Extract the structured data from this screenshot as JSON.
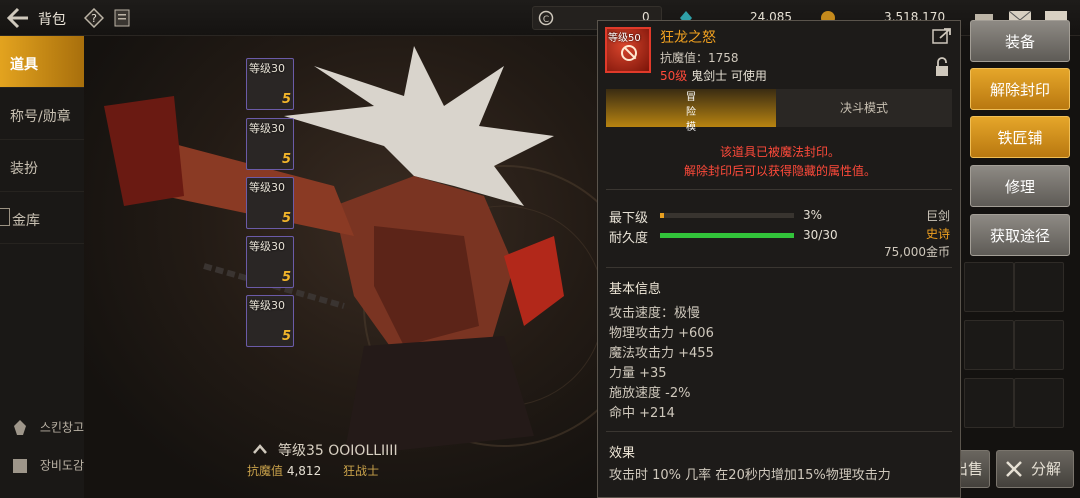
{
  "topbar": {
    "title": "背包",
    "currency_1": "0",
    "currency_2": "24,085",
    "currency_3": "3,518,170"
  },
  "nav": {
    "items": [
      {
        "label": "道具"
      },
      {
        "label": "称号/勋章"
      },
      {
        "label": "装扮"
      },
      {
        "label": "金库"
      }
    ],
    "bottom": [
      {
        "label": "스킨창고"
      },
      {
        "label": "장비도감"
      }
    ]
  },
  "inventory_slots": [
    {
      "level": "等级30",
      "badge": "5"
    },
    {
      "level": "等级30",
      "badge": "5"
    },
    {
      "level": "等级30",
      "badge": "5"
    },
    {
      "level": "等级30",
      "badge": "5"
    },
    {
      "level": "等级30",
      "badge": "5"
    }
  ],
  "character": {
    "level_name": "等级35 OOIOLLIIII",
    "power_label": "抗魔值",
    "power_value": "4,812",
    "class": "狂战士"
  },
  "tooltip": {
    "icon_level": "等级50",
    "name": "狂龙之怒",
    "power": "抗魔值：1758",
    "req_level": "50级",
    "req_class": " 鬼剑士 可使用",
    "tab_a_chars": [
      "冒",
      "险",
      "模",
      "式"
    ],
    "tab_b": "决斗模式",
    "sealed_line_1": "该道具已被魔法封印。",
    "sealed_line_2": "解除封印后可以获得隐藏的属性值。",
    "stat_1_label": "最下级",
    "stat_1_value": "3%",
    "stat_1_progress": 0.03,
    "stat_2_label": "耐久度",
    "stat_2_value": "30/30",
    "stat_2_progress": 1.0,
    "type": "巨剑",
    "rarity": "史诗",
    "price": "75,000金币",
    "basic_title": "基本信息",
    "attributes": [
      "攻击速度：极慢",
      "物理攻击力 +606",
      "魔法攻击力 +455",
      "力量 +35",
      "施放速度 -2%",
      "命中 +214"
    ],
    "effect_title": "效果",
    "effect_text": "攻击时 10% 几率 在20秒内增加15%物理攻击力"
  },
  "actions": {
    "equip": "装备",
    "unseal": "解除封印",
    "blacksmith": "铁匠铺",
    "repair": "修理",
    "obtain": "获取途径"
  },
  "bottom": {
    "sell": "出售",
    "disassemble": "分解"
  },
  "colors": {
    "gold": "#f0a020",
    "red": "#ff4a3a",
    "purple_border": "#6b5ba8"
  }
}
